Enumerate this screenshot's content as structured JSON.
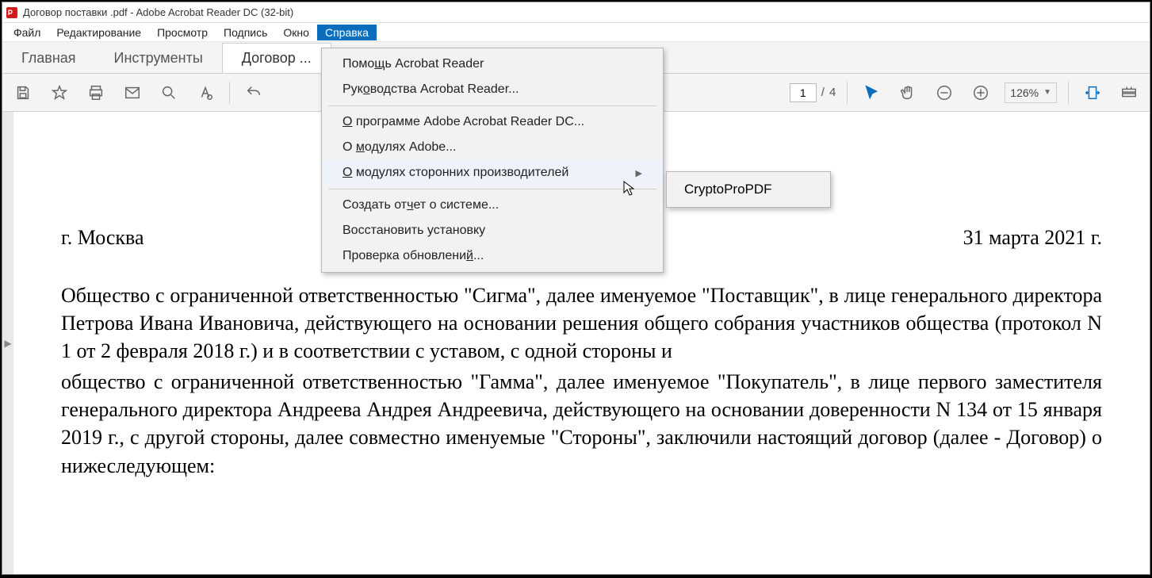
{
  "title": "Договор поставки .pdf - Adobe Acrobat Reader DC (32-bit)",
  "menubar": {
    "file": "Файл",
    "edit": "Редактирование",
    "view": "Просмотр",
    "sign": "Подпись",
    "window": "Окно",
    "help": "Справка"
  },
  "tabs": {
    "home": "Главная",
    "tools": "Инструменты",
    "doc": "Договор ..."
  },
  "toolbar": {
    "page_current": "1",
    "page_sep": "/",
    "page_total": "4",
    "zoom": "126%"
  },
  "help_menu": {
    "help_reader": "Помощь Acrobat Reader",
    "guides": "Руководства Acrobat Reader...",
    "about": "О программе Adobe Acrobat Reader DC...",
    "about_adobe_modules": "О модулях Adobe...",
    "about_third_party": "О модулях сторонних производителей",
    "system_report": "Создать отчет о системе...",
    "repair": "Восстановить установку",
    "updates": "Проверка обновлений..."
  },
  "submenu": {
    "cryptopro": "CryptoProPDF"
  },
  "document": {
    "city": "г. Москва",
    "date": "31 марта 2021 г.",
    "para1": "Общество с ограниченной ответственностью \"Сигма\", далее именуемое \"Поставщик\", в лице генерального директора Петрова Ивана Ивановича, действующего на основании решения общего собрания участников общества (протокол N 1 от 2 февраля 2018 г.) и в соответствии с уставом, с одной стороны и",
    "para2": "общество с ограниченной ответственностью \"Гамма\", далее именуемое \"Покупатель\", в лице первого заместителя генерального директора Андреева Андрея Андреевича, действующего на основании доверенности N 134 от 15 января 2019 г., с другой стороны, далее совместно именуемые \"Стороны\", заключили настоящий договор (далее - Договор) о нижеследующем:"
  }
}
